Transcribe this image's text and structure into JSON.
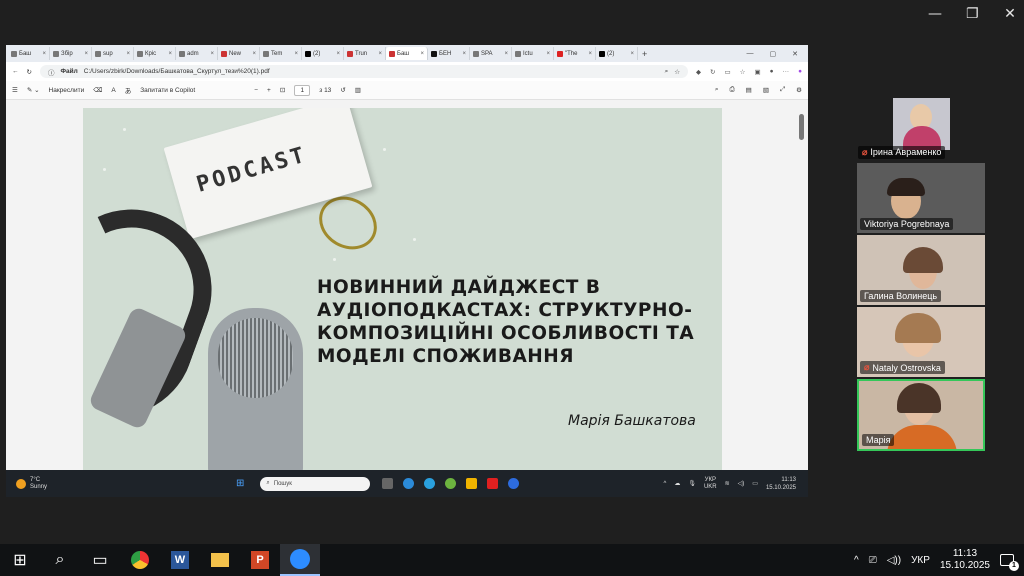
{
  "tabs": [
    "Баш",
    "Збір",
    "sup",
    "Кріс",
    "adm",
    "New",
    "Tem",
    "(2) ",
    "Trun",
    "Баш",
    "БЕН",
    "SPA",
    "Ictu",
    "\"The",
    "(2) "
  ],
  "address": {
    "label": "Файл",
    "path": "C:/Users/zbirk/Downloads/Башкатова_Скуртул_тези%20(1).pdf"
  },
  "pdf_toolbar": {
    "draw": "Накреслити",
    "ask_copilot": "Запитати в Copilot",
    "page": "1",
    "of_pages": "з 13",
    "read_aloud": "A",
    "translate": "あ"
  },
  "slide": {
    "word": "PODCAST",
    "title": "НОВИННИЙ ДАЙДЖЕСТ В АУДІОПОДКАСТАХ: СТРУКТУРНО-КОМПОЗИЦІЙНІ ОСОБЛИВОСТІ ТА МОДЕЛІ СПОЖИВАННЯ",
    "author": "Марія Башкатова"
  },
  "remote_taskbar": {
    "temp": "7°C",
    "condition": "Sunny",
    "search": "Пошук",
    "lang1": "УКР",
    "lang2": "UKR",
    "time": "11:13",
    "date": "15.10.2025"
  },
  "participants": [
    {
      "name": "Ірина Авраменко",
      "muted": true
    },
    {
      "name": "Viktoriya Pogrebnaya",
      "muted": false
    },
    {
      "name": "Галина Волинець",
      "muted": false
    },
    {
      "name": "Nataly Ostrovska",
      "muted": true
    },
    {
      "name": "Марія",
      "muted": false
    }
  ],
  "taskbar": {
    "lang": "УКР",
    "time": "11:13",
    "date": "15.10.2025",
    "notifications": "1"
  },
  "colors": {
    "slide_bg": "#d1ddd3",
    "active_speaker": "#35c759",
    "muted": "#e5533d"
  }
}
